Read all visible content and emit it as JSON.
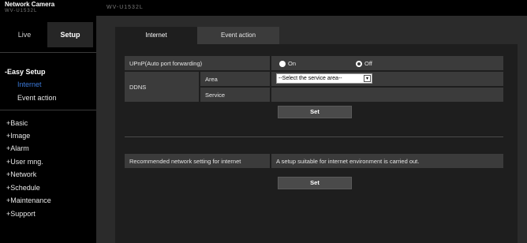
{
  "header": {
    "brand": "Network Camera",
    "brand_sub": "WV-U1532L",
    "camera_name": "WV-U1532L"
  },
  "sidebar": {
    "live_label": "Live",
    "setup_label": "Setup",
    "easy_setup": "-Easy Setup",
    "sub_items": [
      "Internet",
      "Event action"
    ],
    "menu_items": [
      "+Basic",
      "+Image",
      "+Alarm",
      "+User mng.",
      "+Network",
      "+Schedule",
      "+Maintenance",
      "+Support"
    ]
  },
  "tabs": [
    "Internet",
    "Event action"
  ],
  "upnp": {
    "label": "UPnP(Auto port forwarding)",
    "on_label": "On",
    "off_label": "Off",
    "selected": "On"
  },
  "ddns": {
    "label": "DDNS",
    "area_label": "Area",
    "area_value": "--Select the service area--",
    "service_label": "Service",
    "service_value": ""
  },
  "set_button": "Set",
  "recommended": {
    "label": "Recommended network setting for internet",
    "description": "A setup suitable for internet environment is carried out."
  },
  "set_button_2": "Set",
  "colors": {
    "active_menu": "#3a78d8",
    "background": "#1b1b1b",
    "cell": "#3b3b3b"
  }
}
